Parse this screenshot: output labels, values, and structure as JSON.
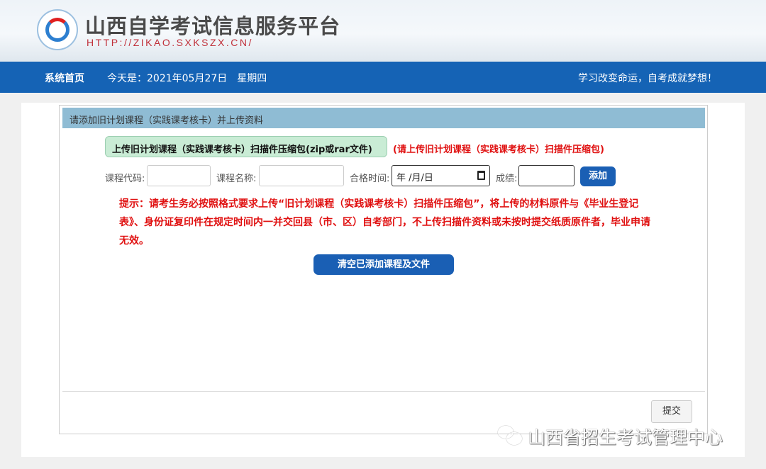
{
  "header": {
    "title": "山西自学考试信息服务平台",
    "url": "HTTP://ZIKAO.SXKSZX.CN/"
  },
  "nav": {
    "home": "系统首页",
    "date": "今天是：2021年05月27日　星期四",
    "slogan": "学习改变命运，自考成就梦想！"
  },
  "panel": {
    "title": "请添加旧计划课程（实践课考核卡）并上传资料",
    "upload_label": "上传旧计划课程（实践课考核卡）扫描件压缩包(zip或rar文件)",
    "upload_hint": "(请上传旧计划课程（实践课考核卡）扫描件压缩包)",
    "form": {
      "code_label": "课程代码:",
      "name_label": "课程名称:",
      "date_label": "合格时间:",
      "date_placeholder": "年 /月/日",
      "score_label": "成绩:",
      "code_value": "",
      "name_value": "",
      "score_value": ""
    },
    "add_label": "添加",
    "tip": "提示：请考生务必按照格式要求上传“旧计划课程（实践课考核卡）扫描件压缩包”，将上传的材料原件与《毕业生登记表》、身份证复印件在规定时间内一并交回县（市、区）自考部门，不上传扫描件资料或未按时提交纸质原件者，毕业申请无效。",
    "clear_label": "清空已添加课程及文件",
    "submit_label": "提交"
  },
  "watermark": "山西省招生考试管理中心"
}
